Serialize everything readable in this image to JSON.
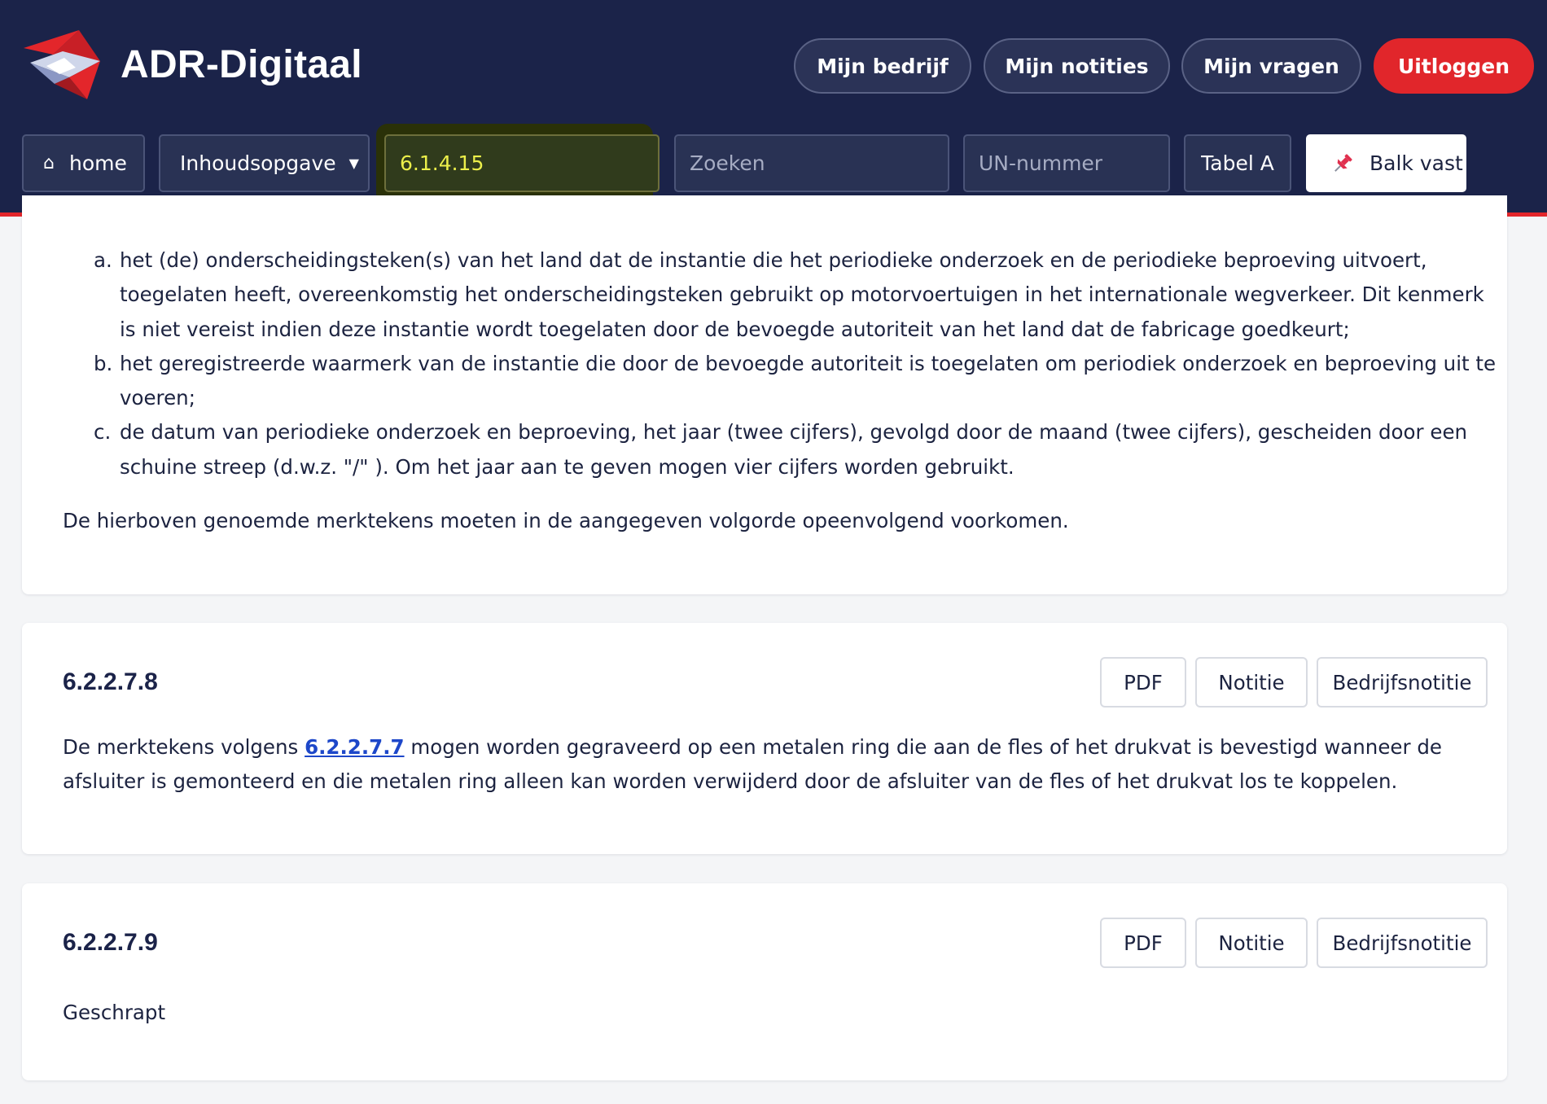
{
  "header": {
    "brand": "ADR-Digitaal",
    "nav": {
      "my_company": "Mijn bedrijf",
      "my_notes": "Mijn notities",
      "my_questions": "Mijn vragen",
      "logout": "Uitloggen"
    },
    "colors": {
      "background": "#1b2349",
      "accent": "#e3262b",
      "goto_text": "#ecef4a"
    }
  },
  "toolbar": {
    "home_icon": "house-icon",
    "home_label": "home",
    "toc_label": "Inhoudsopgave",
    "toc_caret_icon": "caret-down-icon",
    "goto_value": "6.1.4.15",
    "search_placeholder": "Zoeken",
    "un_placeholder": "UN-nummer",
    "tabel_label": "Tabel A",
    "pin_icon": "pushpin-icon",
    "pin_label": "Balk vast"
  },
  "sections": [
    {
      "list": [
        {
          "marker": "a.",
          "text": "het (de) onderscheidingsteken(s) van het land dat de instantie die het periodieke onderzoek en de periodieke beproeving uitvoert, toegelaten heeft, overeenkomstig het onderscheidingsteken gebruikt op motorvoertuigen in het internationale wegverkeer. Dit kenmerk is niet vereist indien deze instantie wordt toegelaten door de bevoegde autoriteit van het land dat de fabricage goedkeurt;"
        },
        {
          "marker": "b.",
          "text": "het geregistreerde waarmerk van de instantie die door de bevoegde autoriteit is toegelaten om periodiek onderzoek en beproeving uit te voeren;"
        },
        {
          "marker": "c.",
          "text": "de datum van periodieke onderzoek en beproeving, het jaar (twee cijfers), gevolgd door de maand (twee cijfers), gescheiden door een schuine streep (d.w.z. \"/\" ). Om het jaar aan te geven mogen vier cijfers worden gebruikt."
        }
      ],
      "paragraph": "De hierboven genoemde merktekens moeten in de aangegeven volgorde opeenvolgend voorkomen."
    },
    {
      "id": "6.2.2.7.8",
      "buttons": {
        "pdf": "PDF",
        "note": "Notitie",
        "company_note": "Bedrijfsnotitie"
      },
      "paragraph_before": "De merktekens volgens ",
      "link": "6.2.2.7.7",
      "paragraph_after": " mogen worden gegraveerd op een metalen ring die aan de fles of het drukvat is bevestigd wanneer de afsluiter is gemonteerd en die metalen ring alleen kan worden verwijderd door de afsluiter van de fles of het drukvat los te koppelen."
    },
    {
      "id": "6.2.2.7.9",
      "buttons": {
        "pdf": "PDF",
        "note": "Notitie",
        "company_note": "Bedrijfsnotitie"
      },
      "paragraph": "Geschrapt"
    }
  ]
}
